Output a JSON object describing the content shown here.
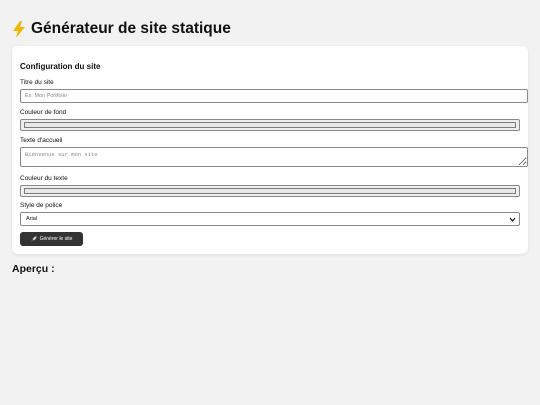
{
  "header": {
    "icon": "lightning-bolt-icon",
    "title": "Générateur de site statique"
  },
  "config": {
    "title": "Configuration du site",
    "site_title": {
      "label": "Titre du site",
      "value": "",
      "placeholder": "Ex: Mon Portfolio"
    },
    "bg_color": {
      "label": "Couleur de fond",
      "value": ""
    },
    "welcome": {
      "label": "Texte d'accueil",
      "value": "",
      "placeholder": "Bienvenue sur mon site"
    },
    "text_color": {
      "label": "Couleur du texte",
      "value": ""
    },
    "font": {
      "label": "Style de police",
      "selected": "Arial"
    },
    "button": {
      "icon": "rocket-icon",
      "label": "Générer le site"
    }
  },
  "preview": {
    "title": "Aperçu :"
  },
  "colors": {
    "page_background": "#f2f2f2",
    "card_background": "#ffffff",
    "button_background": "#333333",
    "bolt": "#f5b400"
  }
}
